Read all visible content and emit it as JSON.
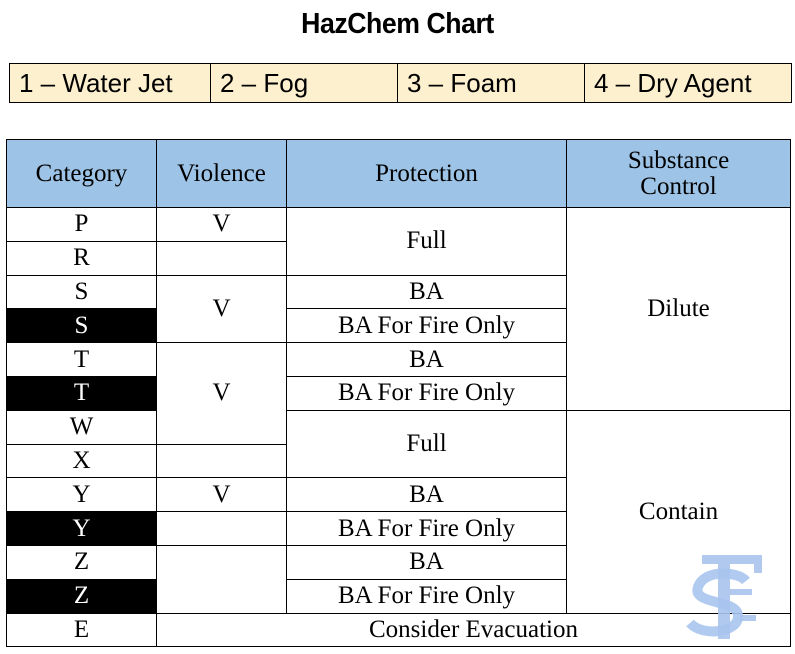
{
  "title": "HazChem Chart",
  "legend": [
    "1 – Water Jet",
    "2 – Fog",
    "3 – Foam",
    "4 – Dry Agent"
  ],
  "table": {
    "headers": [
      "Category",
      "Violence",
      "Protection",
      "Substance\nControl"
    ],
    "header_substance_line1": "Substance",
    "header_substance_line2": "Control",
    "rows": [
      {
        "category": "P",
        "inverted": false
      },
      {
        "category": "R",
        "inverted": false
      },
      {
        "category": "S",
        "inverted": false
      },
      {
        "category": "S",
        "inverted": true
      },
      {
        "category": "T",
        "inverted": false
      },
      {
        "category": "T",
        "inverted": true
      },
      {
        "category": "W",
        "inverted": false
      },
      {
        "category": "X",
        "inverted": false
      },
      {
        "category": "Y",
        "inverted": false
      },
      {
        "category": "Y",
        "inverted": true
      },
      {
        "category": "Z",
        "inverted": false
      },
      {
        "category": "Z",
        "inverted": true
      },
      {
        "category": "E",
        "inverted": false
      }
    ],
    "violence": {
      "p": "V",
      "r": "",
      "s": "V",
      "t_w": "V",
      "x": "",
      "y": "V",
      "y_inv": "",
      "z": ""
    },
    "protection": {
      "pr": "Full",
      "s": "BA",
      "s_inv": "BA For Fire Only",
      "t": "BA",
      "t_inv": "BA For Fire Only",
      "wx": "Full",
      "y": "BA",
      "y_inv": "BA For Fire Only",
      "z": "BA",
      "z_inv": "BA For Fire Only"
    },
    "substance_control": {
      "upper": "Dilute",
      "lower": "Contain"
    },
    "evacuation": "Consider Evacuation"
  },
  "watermark": {
    "name": "sf-logo-watermark",
    "color": "#a9c4ee"
  },
  "colors": {
    "legend_bg": "#fdf0cf",
    "header_bg": "#9dc3e6",
    "inverted_bg": "#000000",
    "inverted_text": "#ffffff"
  }
}
